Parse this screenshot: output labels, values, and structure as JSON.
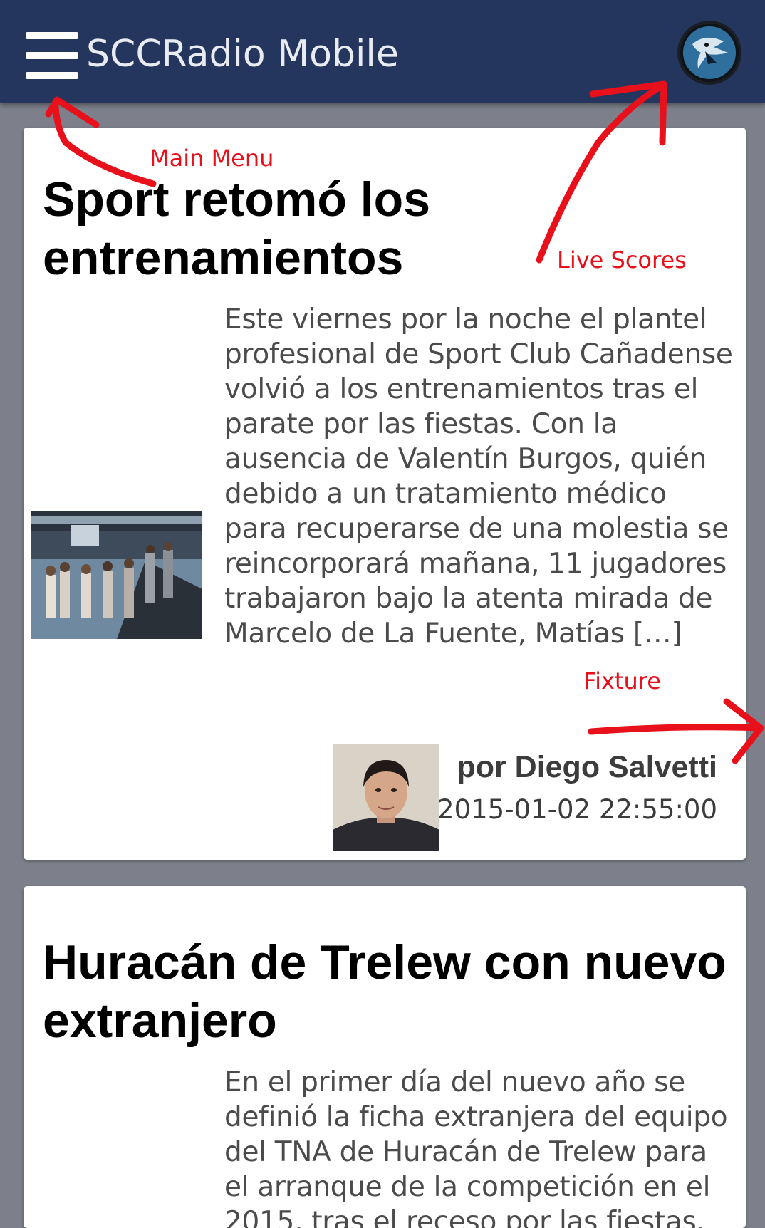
{
  "appbar": {
    "title": "SCCRadio Mobile",
    "background": "#24355e",
    "menu_icon": "hamburger-menu-icon",
    "logo_icon": "team-logo-icon"
  },
  "articles": [
    {
      "title": "Sport retomó los entrenamientos",
      "excerpt": "Este viernes por la noche el plantel profesional de Sport Club Cañadense volvió a los entrenamientos tras el parate por las fiestas. Con la ausencia de Valentín Burgos, quién debido a un tratamiento médico para recuperarse de una molestia se reincorporará mañana, 11 jugadores trabajaron bajo la atenta mirada de Marcelo de La Fuente, Matías […]",
      "author": "por Diego Salvetti",
      "date": "2015-01-02 22:55:00"
    },
    {
      "title": "Huracán de Trelew con nuevo extranjero",
      "excerpt": "En el primer día del nuevo año se definió la ficha extranjera del equipo del TNA de Huracán de Trelew para el arranque de la competición en el 2015, tras el receso por las fiestas. El"
    }
  ],
  "annotations": {
    "main_menu": "Main Menu",
    "live_scores": "Live Scores",
    "fixture": "Fixture",
    "color": "#e8101a"
  }
}
